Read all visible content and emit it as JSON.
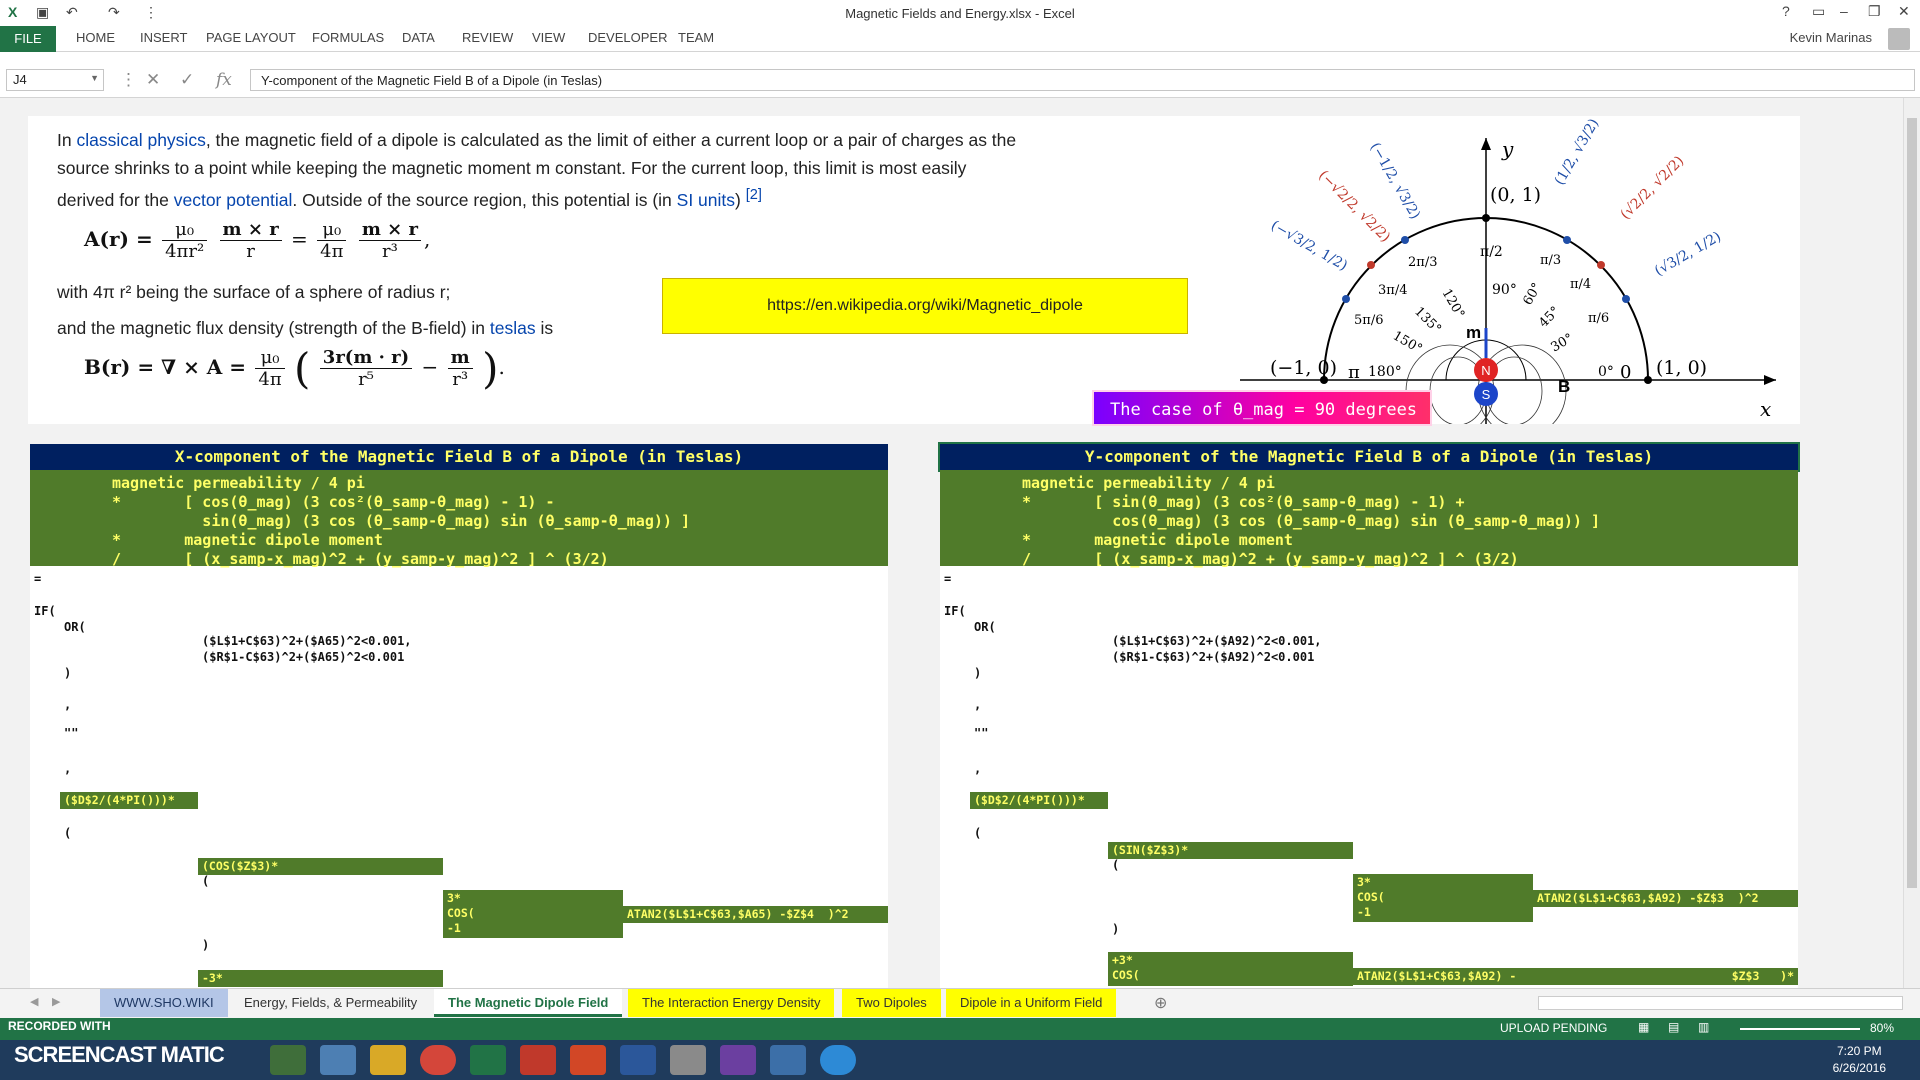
{
  "window": {
    "title": "Magnetic Fields and Energy.xlsx - Excel"
  },
  "ribbon": {
    "tabs": [
      "FILE",
      "HOME",
      "INSERT",
      "PAGE LAYOUT",
      "FORMULAS",
      "DATA",
      "REVIEW",
      "VIEW",
      "DEVELOPER",
      "TEAM"
    ],
    "user": "Kevin Marinas"
  },
  "formula_bar": {
    "name_box": "J4",
    "formula": "Y-component of the Magnetic Field B of a Dipole (in Teslas)",
    "fx": "fx"
  },
  "wiki": {
    "p1_a": "In ",
    "p1_link1": "classical physics",
    "p1_b": ", the magnetic field of a dipole is calculated as the limit of either a current loop or a pair of charges as the",
    "p2": "source shrinks to a point while keeping the magnetic moment m constant. For the current loop, this limit is most easily",
    "p3_a": "derived for the ",
    "p3_link": "vector potential",
    "p3_b": ". Outside of the source region, this potential is (in ",
    "p3_link2": "SI units",
    "p3_c": ")",
    "p3_ref": "[2]",
    "p4": "with 4π r² being the surface of a sphere of radius r;",
    "p5_a": "and the magnetic flux density (strength of the B-field) in ",
    "p5_link": "teslas",
    "p5_b": " is",
    "eq1_lhs": "A(r) =",
    "eq1_mid": "=",
    "eq1_tail": ",",
    "eq_mu0": "μ₀",
    "eq_4pir2": "4πr²",
    "eq_mxr": "m × r",
    "eq_r": "r",
    "eq_4pi": "4π",
    "eq_r3": "r³",
    "eq2_lhs": "B(r) = ∇ × A =",
    "eq2_num1": "3r(m · r)",
    "eq2_den1": "r⁵",
    "eq2_minus": "−",
    "eq2_num2": "m",
    "eq2_den2": "r³",
    "eq2_tail": "."
  },
  "url_box": "https://en.wikipedia.org/wiki/Magnetic_dipole",
  "unit_circle": {
    "axis_x": "x",
    "axis_y": "y",
    "points": [
      "(0, 1)",
      "(−1, 0)",
      "(1, 0)"
    ],
    "angles": [
      "90°",
      "60°",
      "45°",
      "30°",
      "120°",
      "135°",
      "150°",
      "180°",
      "0°"
    ],
    "radians": [
      "π/2",
      "π/3",
      "π/4",
      "π/6",
      "2π/3",
      "3π/4",
      "5π/6",
      "π",
      "0"
    ],
    "m_label": "m",
    "b_label": "B",
    "n_label": "N",
    "s_label": "S",
    "coords": [
      "(1/2, √3/2)",
      "(√2/2, √2/2)",
      "(√3/2, 1/2)",
      "(−1/2, √3/2)",
      "(−√2/2, √2/2)",
      "(−√3/2, 1/2)"
    ]
  },
  "case_box": "The case of θ_mag = 90 degrees",
  "left_panel": {
    "header": "X-component of the Magnetic Field B of a Dipole (in Teslas)",
    "description": "magnetic permeability / 4 pi\n*       [ cos(θ_mag) (3 cos²(θ_samp-θ_mag) - 1) -\n          sin(θ_mag) (3 cos (θ_samp-θ_mag) sin (θ_samp-θ_mag)) ]\n*       magnetic dipole moment\n/       [ (x_samp-x_mag)^2 + (y_samp-y_mag)^2 ] ^ (3/2)",
    "eq": "=",
    "if": "IF(",
    "or": "OR(",
    "cond1": "($L$1+C$63)^2+($A65)^2<0.001,",
    "cond2": "($R$1-C$63)^2+($A65)^2<0.001",
    "close1": ")",
    "comma1": ",",
    "empty": "\"\"",
    "comma2": ",",
    "g1": "($D$2/(4*PI()))*",
    "open": "(",
    "g2": "(COS($Z$3)*",
    "open2": "(",
    "g3": "3*\nCOS(\n-1",
    "g4": "ATAN2($L$1+C$63,$A65) -$Z$4  )^2",
    "close2": ")",
    "g5": "-3*"
  },
  "right_panel": {
    "header": "Y-component of the Magnetic Field B of a Dipole (in Teslas)",
    "description": "magnetic permeability / 4 pi\n*       [ sin(θ_mag) (3 cos²(θ_samp-θ_mag) - 1) +\n          cos(θ_mag) (3 cos (θ_samp-θ_mag) sin (θ_samp-θ_mag)) ]\n*       magnetic dipole moment\n/       [ (x_samp-x_mag)^2 + (y_samp-y_mag)^2 ] ^ (3/2)",
    "eq": "=",
    "if": "IF(",
    "or": "OR(",
    "cond1": "($L$1+C$63)^2+($A92)^2<0.001,",
    "cond2": "($R$1-C$63)^2+($A92)^2<0.001",
    "close1": ")",
    "comma1": ",",
    "empty": "\"\"",
    "comma2": ",",
    "g1": "($D$2/(4*PI()))*",
    "open": "(",
    "g2": "(SIN($Z$3)*",
    "open2": "(",
    "g3": "3*\nCOS(\n-1",
    "g4": "ATAN2($L$1+C$63,$A92) -$Z$3  )^2",
    "close2": ")",
    "g5": "+3*\nCOS(",
    "g6": "ATAN2($L$1+C$63,$A92) -",
    "g7": "$Z$3   )*"
  },
  "sheet_tabs": [
    "WWW.SHO.WIKI",
    "Energy, Fields, & Permeability",
    "The Magnetic Dipole Field",
    "The Interaction Energy Density",
    "Two Dipoles",
    "Dipole in a Uniform Field"
  ],
  "status": {
    "recorded": "RECORDED WITH",
    "upload": "UPLOAD PENDING",
    "zoom": "80%"
  },
  "taskbar": {
    "brand": "SCREENCAST MATIC",
    "time": "7:20 PM",
    "date": "6/26/2016"
  },
  "colors": {
    "excel_green": "#217346",
    "header_navy": "#002060",
    "cell_green": "#507b2a",
    "cell_text": "#ffff66",
    "url_yellow": "#ffff00"
  }
}
